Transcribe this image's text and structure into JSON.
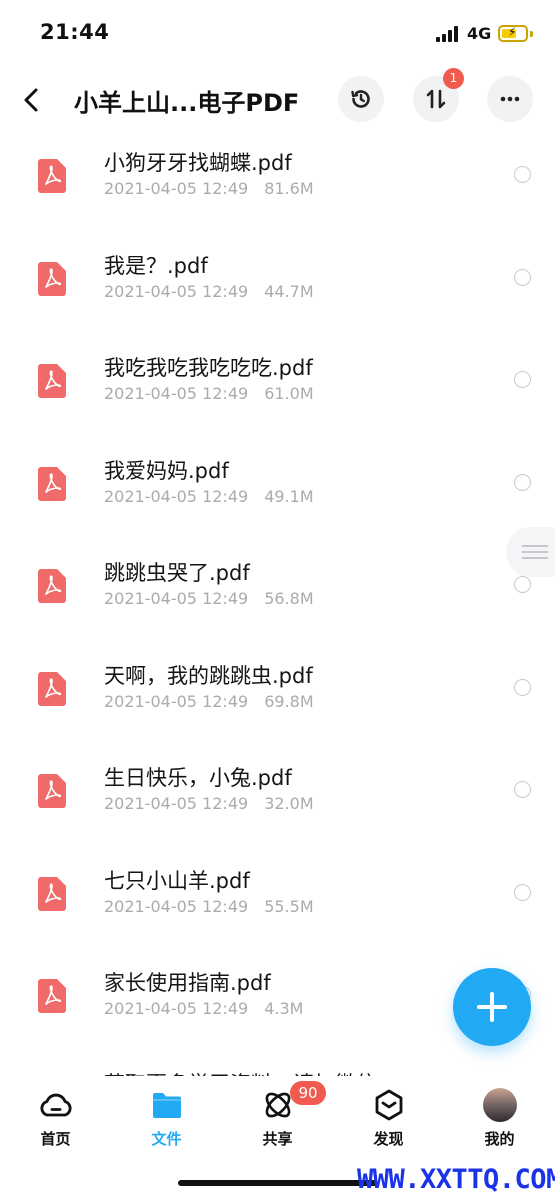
{
  "status_bar": {
    "time": "21:44",
    "network": "4G"
  },
  "header": {
    "title": "小羊上山...电子PDF",
    "transfer_badge": "1"
  },
  "files": [
    {
      "name": "小狗牙牙找蝴蝶.pdf",
      "date": "2021-04-05 12:49",
      "size": "81.6M"
    },
    {
      "name": "我是？.pdf",
      "date": "2021-04-05 12:49",
      "size": "44.7M"
    },
    {
      "name": "我吃我吃我吃吃吃.pdf",
      "date": "2021-04-05 12:49",
      "size": "61.0M"
    },
    {
      "name": "我爱妈妈.pdf",
      "date": "2021-04-05 12:49",
      "size": "49.1M"
    },
    {
      "name": "跳跳虫哭了.pdf",
      "date": "2021-04-05 12:49",
      "size": "56.8M"
    },
    {
      "name": "天啊，我的跳跳虫.pdf",
      "date": "2021-04-05 12:49",
      "size": "69.8M"
    },
    {
      "name": "生日快乐，小兔.pdf",
      "date": "2021-04-05 12:49",
      "size": "32.0M"
    },
    {
      "name": "七只小山羊.pdf",
      "date": "2021-04-05 12:49",
      "size": "55.5M"
    },
    {
      "name": "家长使用指南.pdf",
      "date": "2021-04-05 12:49",
      "size": "4.3M"
    }
  ],
  "partial_row_text": "获取更多学习资料，请加微信",
  "tabs": [
    {
      "label": "首页",
      "icon": "cloud-icon"
    },
    {
      "label": "文件",
      "icon": "folder-icon"
    },
    {
      "label": "共享",
      "icon": "share-orbit-icon"
    },
    {
      "label": "发现",
      "icon": "discover-cube-icon"
    },
    {
      "label": "我的",
      "icon": "avatar"
    }
  ],
  "share_badge": "90",
  "watermark": "WWW.XXTTQ.COM",
  "colors": {
    "accent": "#22a9f4",
    "badge": "#f05a4f",
    "pdf_icon": "#f06a6a",
    "meta_text": "#a9abb0"
  }
}
